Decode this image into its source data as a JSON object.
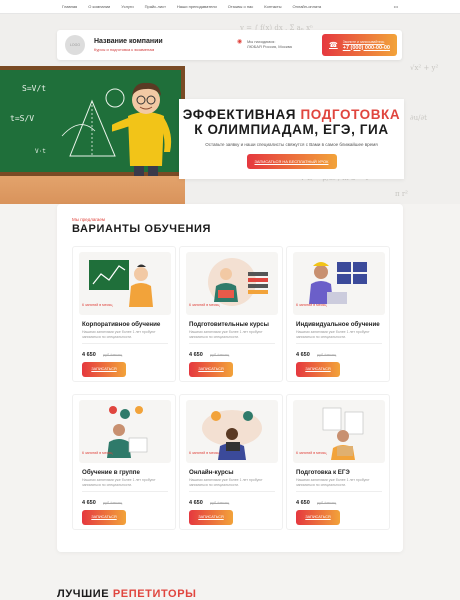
{
  "topnav": [
    "Главная",
    "О компании",
    "Услуги",
    "Прайс-лист",
    "Наши преподаватели",
    "Отзывы о нас",
    "Контакты",
    "Онлайн-оплата"
  ],
  "topnav_more": "•••",
  "header": {
    "logo_text": "LOGO",
    "company_name": "Название компании",
    "tagline": "Курсы и подготовка к экзаменам",
    "address_l1": "Мы находимся:",
    "address_l2": "ЛЮБАЯ Россия, Москва",
    "phone_label": "Звоните и записывайтесь",
    "phone": "+7 (000) 000-00-00"
  },
  "hero": {
    "title_a": "ЭФФЕКТИВНАЯ ",
    "title_accent": "ПОДГОТОВКА",
    "title_b": "К ОЛИМПИАДАМ, ЕГЭ, ГИА",
    "subtitle": "Оставьте заявку и наши специалисты свяжутся с Вами в самое ближайшее время",
    "cta": "Записаться на бесплатный урок"
  },
  "section": {
    "kicker": "Мы предлагаем",
    "title": "ВАРИАНТЫ ОБУЧЕНИЯ",
    "cards": [
      {
        "badge": "6 занятий в месяц",
        "title": "Корпоративное обучение",
        "desc": "Нашими занятиями уже более 1 лет пробуют заниматься по специальности.",
        "price": "4 650",
        "old": "руб./месяц",
        "btn": "Записаться"
      },
      {
        "badge": "6 занятий в месяц",
        "title": "Подготовительные курсы",
        "desc": "Нашими занятиями уже более 1 лет пробуют заниматься по специальности.",
        "price": "4 650",
        "old": "руб./месяц",
        "btn": "Записаться"
      },
      {
        "badge": "6 занятий в месяц",
        "title": "Индивидуальное обучение",
        "desc": "Нашими занятиями уже более 1 лет пробуют заниматься по специальности.",
        "price": "4 650",
        "old": "руб./месяц",
        "btn": "Записаться"
      },
      {
        "badge": "6 занятий в месяц",
        "title": "Обучение в группе",
        "desc": "Нашими занятиями уже более 1 лет пробуют заниматься по специальности.",
        "price": "4 650",
        "old": "руб./месяц",
        "btn": "Записаться"
      },
      {
        "badge": "6 занятий в месяц",
        "title": "Онлайн-курсы",
        "desc": "Нашими занятиями уже более 1 лет пробуют заниматься по специальности.",
        "price": "4 650",
        "old": "руб./месяц",
        "btn": "Записаться"
      },
      {
        "badge": "6 занятий в месяц",
        "title": "Подготовка к ЕГЭ",
        "desc": "Нашими занятиями уже более 1 лет пробуют заниматься по специальности.",
        "price": "4 650",
        "old": "руб./месяц",
        "btn": "Записаться"
      }
    ]
  },
  "bottom": {
    "title_a": "ЛУЧШИЕ ",
    "title_accent": "РЕПЕТИТОРЫ"
  },
  "colors": {
    "accent": "#e0453e",
    "gradient_start": "#e5383f",
    "gradient_end": "#f2a33a",
    "board": "#1f6f3a"
  }
}
